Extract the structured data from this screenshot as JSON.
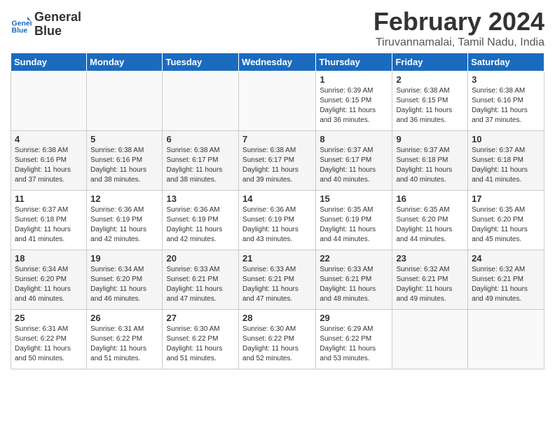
{
  "header": {
    "logo_line1": "General",
    "logo_line2": "Blue",
    "title": "February 2024",
    "subtitle": "Tiruvannamalai, Tamil Nadu, India"
  },
  "weekdays": [
    "Sunday",
    "Monday",
    "Tuesday",
    "Wednesday",
    "Thursday",
    "Friday",
    "Saturday"
  ],
  "weeks": [
    [
      {
        "day": "",
        "info": ""
      },
      {
        "day": "",
        "info": ""
      },
      {
        "day": "",
        "info": ""
      },
      {
        "day": "",
        "info": ""
      },
      {
        "day": "1",
        "info": "Sunrise: 6:39 AM\nSunset: 6:15 PM\nDaylight: 11 hours\nand 36 minutes."
      },
      {
        "day": "2",
        "info": "Sunrise: 6:38 AM\nSunset: 6:15 PM\nDaylight: 11 hours\nand 36 minutes."
      },
      {
        "day": "3",
        "info": "Sunrise: 6:38 AM\nSunset: 6:16 PM\nDaylight: 11 hours\nand 37 minutes."
      }
    ],
    [
      {
        "day": "4",
        "info": "Sunrise: 6:38 AM\nSunset: 6:16 PM\nDaylight: 11 hours\nand 37 minutes."
      },
      {
        "day": "5",
        "info": "Sunrise: 6:38 AM\nSunset: 6:16 PM\nDaylight: 11 hours\nand 38 minutes."
      },
      {
        "day": "6",
        "info": "Sunrise: 6:38 AM\nSunset: 6:17 PM\nDaylight: 11 hours\nand 38 minutes."
      },
      {
        "day": "7",
        "info": "Sunrise: 6:38 AM\nSunset: 6:17 PM\nDaylight: 11 hours\nand 39 minutes."
      },
      {
        "day": "8",
        "info": "Sunrise: 6:37 AM\nSunset: 6:17 PM\nDaylight: 11 hours\nand 40 minutes."
      },
      {
        "day": "9",
        "info": "Sunrise: 6:37 AM\nSunset: 6:18 PM\nDaylight: 11 hours\nand 40 minutes."
      },
      {
        "day": "10",
        "info": "Sunrise: 6:37 AM\nSunset: 6:18 PM\nDaylight: 11 hours\nand 41 minutes."
      }
    ],
    [
      {
        "day": "11",
        "info": "Sunrise: 6:37 AM\nSunset: 6:18 PM\nDaylight: 11 hours\nand 41 minutes."
      },
      {
        "day": "12",
        "info": "Sunrise: 6:36 AM\nSunset: 6:19 PM\nDaylight: 11 hours\nand 42 minutes."
      },
      {
        "day": "13",
        "info": "Sunrise: 6:36 AM\nSunset: 6:19 PM\nDaylight: 11 hours\nand 42 minutes."
      },
      {
        "day": "14",
        "info": "Sunrise: 6:36 AM\nSunset: 6:19 PM\nDaylight: 11 hours\nand 43 minutes."
      },
      {
        "day": "15",
        "info": "Sunrise: 6:35 AM\nSunset: 6:19 PM\nDaylight: 11 hours\nand 44 minutes."
      },
      {
        "day": "16",
        "info": "Sunrise: 6:35 AM\nSunset: 6:20 PM\nDaylight: 11 hours\nand 44 minutes."
      },
      {
        "day": "17",
        "info": "Sunrise: 6:35 AM\nSunset: 6:20 PM\nDaylight: 11 hours\nand 45 minutes."
      }
    ],
    [
      {
        "day": "18",
        "info": "Sunrise: 6:34 AM\nSunset: 6:20 PM\nDaylight: 11 hours\nand 46 minutes."
      },
      {
        "day": "19",
        "info": "Sunrise: 6:34 AM\nSunset: 6:20 PM\nDaylight: 11 hours\nand 46 minutes."
      },
      {
        "day": "20",
        "info": "Sunrise: 6:33 AM\nSunset: 6:21 PM\nDaylight: 11 hours\nand 47 minutes."
      },
      {
        "day": "21",
        "info": "Sunrise: 6:33 AM\nSunset: 6:21 PM\nDaylight: 11 hours\nand 47 minutes."
      },
      {
        "day": "22",
        "info": "Sunrise: 6:33 AM\nSunset: 6:21 PM\nDaylight: 11 hours\nand 48 minutes."
      },
      {
        "day": "23",
        "info": "Sunrise: 6:32 AM\nSunset: 6:21 PM\nDaylight: 11 hours\nand 49 minutes."
      },
      {
        "day": "24",
        "info": "Sunrise: 6:32 AM\nSunset: 6:21 PM\nDaylight: 11 hours\nand 49 minutes."
      }
    ],
    [
      {
        "day": "25",
        "info": "Sunrise: 6:31 AM\nSunset: 6:22 PM\nDaylight: 11 hours\nand 50 minutes."
      },
      {
        "day": "26",
        "info": "Sunrise: 6:31 AM\nSunset: 6:22 PM\nDaylight: 11 hours\nand 51 minutes."
      },
      {
        "day": "27",
        "info": "Sunrise: 6:30 AM\nSunset: 6:22 PM\nDaylight: 11 hours\nand 51 minutes."
      },
      {
        "day": "28",
        "info": "Sunrise: 6:30 AM\nSunset: 6:22 PM\nDaylight: 11 hours\nand 52 minutes."
      },
      {
        "day": "29",
        "info": "Sunrise: 6:29 AM\nSunset: 6:22 PM\nDaylight: 11 hours\nand 53 minutes."
      },
      {
        "day": "",
        "info": ""
      },
      {
        "day": "",
        "info": ""
      }
    ]
  ]
}
